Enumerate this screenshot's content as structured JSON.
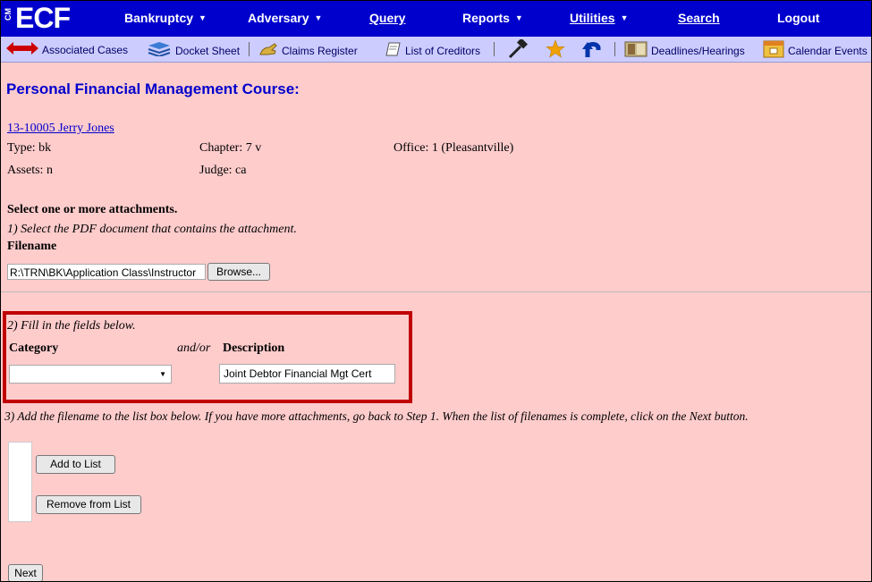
{
  "logo": {
    "cm": "CM",
    "ecf": "ECF"
  },
  "menu": [
    {
      "label": "Bankruptcy",
      "dropdown": true
    },
    {
      "label": "Adversary",
      "dropdown": true
    },
    {
      "label": "Query",
      "dropdown": false
    },
    {
      "label": "Reports",
      "dropdown": true
    },
    {
      "label": "Utilities",
      "dropdown": true
    },
    {
      "label": "Search",
      "dropdown": false
    },
    {
      "label": "Logout",
      "dropdown": false
    }
  ],
  "toolbar": {
    "associated_cases": "Associated Cases",
    "docket_sheet": "Docket Sheet",
    "claims_register": "Claims Register",
    "list_of_creditors": "List of Creditors",
    "deadlines_hearings": "Deadlines/Hearings",
    "calendar_events": "Calendar Events"
  },
  "page": {
    "title": "Personal Financial Management Course:",
    "case_link": "13-10005 Jerry Jones",
    "type": "Type: bk",
    "chapter": "Chapter: 7 v",
    "office": "Office: 1 (Pleasantville)",
    "assets": "Assets: n",
    "judge": "Judge: ca"
  },
  "attachments": {
    "heading": "Select one or more attachments.",
    "step1": "1) Select the PDF document that contains the attachment.",
    "filename_label": "Filename",
    "filename_value": "R:\\TRN\\BK\\Application Class\\Instructor",
    "browse_label": "Browse...",
    "step2": "2) Fill in the fields below.",
    "category_label": "Category",
    "andor": "and/or",
    "description_label": "Description",
    "category_value": "",
    "description_value": "Joint Debtor Financial Mgt Cert",
    "step3": "3) Add the filename to the list box below. If you have more attachments, go back to Step 1. When the list of filenames is complete, click on the Next button.",
    "add_label": "Add to List",
    "remove_label": "Remove from List",
    "next_label": "Next"
  },
  "colors": {
    "menubar": "#0000cc",
    "toolbar": "#ccccff",
    "background": "#ffcccc",
    "highlight": "#c00000"
  }
}
